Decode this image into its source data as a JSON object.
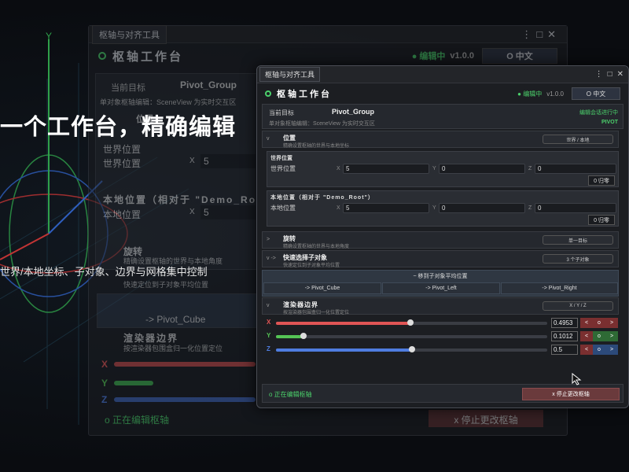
{
  "headline": "一个工作台，精确编辑",
  "subline": "世界/本地坐标、子对象、边界与网格集中控制",
  "bg_window": {
    "tab": "枢轴与对齐工具",
    "title": "枢轴工作台",
    "edit_status": "● 编辑中",
    "version": "v1.0.0",
    "lang": "O 中文",
    "target_label": "当前目标",
    "target_name": "Pivot_Group",
    "hint": "单对象枢轴编辑：SceneView 为实时交互区",
    "pos_short": "位置",
    "world_heading": "世界位置",
    "world_label": "世界位置",
    "x_axis": "X",
    "x_value": "5",
    "local_heading": "本地位置（相对于 \"Demo_Root\"）",
    "local_label": "本地位置",
    "rot_title": "旋转",
    "rot_desc": "精确设置枢轴的世界与本地角度",
    "quick_desc": "快速定位到子对象平均位置",
    "move_btn": "-> Pivot_Cube",
    "bounds_title": "渲染器边界",
    "bounds_desc": "按渲染器包围盒归一化位置定位",
    "x": "X",
    "y": "Y",
    "z": "Z",
    "footer_status": "o 正在编辑枢轴",
    "stop_btn": "x 停止更改枢轴"
  },
  "window": {
    "tab": "枢轴与对齐工具",
    "controls": {
      "menu": "⋮",
      "max": "□",
      "close": "✕"
    },
    "title": "枢轴工作台",
    "edit_status": "● 编辑中",
    "version": "v1.0.0",
    "lang": "O 中文",
    "target": {
      "label": "当前目标",
      "name": "Pivot_Group",
      "hint": "单对象枢轴编辑：SceneView 为实时交互区",
      "status": "编辑会话进行中",
      "pivot": "PIVOT"
    },
    "position": {
      "arrow": "v",
      "title": "位置",
      "desc": "精确设置枢轴的世界与本地坐标",
      "pill": "世界 / 本地",
      "world": {
        "heading": "世界位置",
        "label": "世界位置",
        "x": "5",
        "y": "0",
        "z": "0",
        "zero": "0 归零"
      },
      "local": {
        "heading": "本地位置（相对于 \"Demo_Root\"）",
        "label": "本地位置",
        "x": "5",
        "y": "0",
        "z": "0",
        "zero": "0 归零"
      }
    },
    "axes": {
      "x": "X",
      "y": "Y",
      "z": "Z"
    },
    "rotation": {
      "arrow": ">",
      "title": "旋转",
      "desc": "精确设置枢轴的世界与本地角度",
      "pill": "单一目标"
    },
    "quick": {
      "arrow": "v ->",
      "title": "快速选择子对象",
      "desc": "快速定位到子对象平均位置",
      "pill": "3 个子对象"
    },
    "move": {
      "title": "~ 移到子对象平均位置",
      "buttons": [
        "-> Pivot_Cube",
        "-> Pivot_Left",
        "-> Pivot_Right"
      ]
    },
    "bounds": {
      "arrow": "v",
      "title": "渲染器边界",
      "desc": "按渲染器包围盒归一化位置定位",
      "pill": "X / Y / Z",
      "sliders": [
        {
          "axis": "X",
          "value": "0.4953",
          "fraction": 0.4953,
          "color": "#e05555"
        },
        {
          "axis": "Y",
          "value": "0.1012",
          "fraction": 0.1012,
          "color": "#55c455"
        },
        {
          "axis": "Z",
          "value": "0.5",
          "fraction": 0.5,
          "color": "#4f7de0"
        }
      ],
      "step": {
        "minus": "<",
        "center": "o",
        "plus": ">"
      }
    },
    "footer": {
      "status": "o 正在编辑枢轴",
      "stop": "x 停止更改枢轴"
    }
  }
}
